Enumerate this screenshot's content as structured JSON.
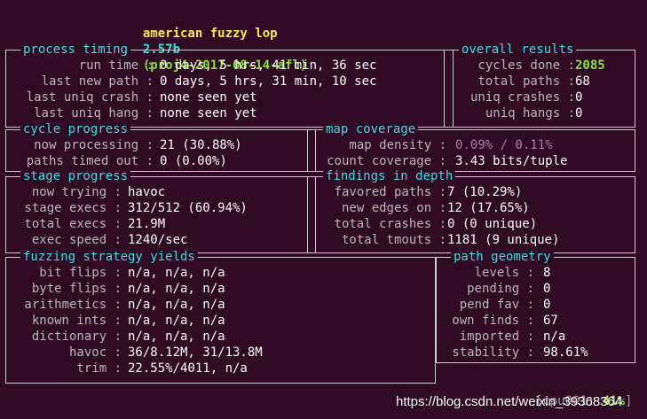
{
  "header": {
    "app_name": "american fuzzy lop",
    "version": "2.57b",
    "banner": "(proj4-2017-08-14-afl)"
  },
  "process_timing": {
    "title": "process timing",
    "rows": [
      {
        "label": "run time",
        "value": "0 days, 5 hrs, 41 min, 36 sec"
      },
      {
        "label": "last new path",
        "value": "0 days, 5 hrs, 31 min, 10 sec"
      },
      {
        "label": "last uniq crash",
        "value": "none seen yet"
      },
      {
        "label": "last uniq hang",
        "value": "none seen yet"
      }
    ]
  },
  "overall_results": {
    "title": "overall results",
    "rows": [
      {
        "label": "cycles done",
        "value": "2085"
      },
      {
        "label": "total paths",
        "value": "68"
      },
      {
        "label": "uniq crashes",
        "value": "0"
      },
      {
        "label": "uniq hangs",
        "value": "0"
      }
    ]
  },
  "cycle_progress": {
    "title": "cycle progress",
    "rows": [
      {
        "label": "now processing",
        "value": "21 (30.88%)"
      },
      {
        "label": "paths timed out",
        "value": "0 (0.00%)"
      }
    ]
  },
  "map_coverage": {
    "title": "map coverage",
    "rows": [
      {
        "label": "map density",
        "value": "0.09% / 0.11%"
      },
      {
        "label": "count coverage",
        "value": "3.43 bits/tuple"
      }
    ]
  },
  "stage_progress": {
    "title": "stage progress",
    "rows": [
      {
        "label": "now trying",
        "value": "havoc"
      },
      {
        "label": "stage execs",
        "value": "312/512 (60.94%)"
      },
      {
        "label": "total execs",
        "value": "21.9M"
      },
      {
        "label": "exec speed",
        "value": "1240/sec"
      }
    ]
  },
  "findings_in_depth": {
    "title": "findings in depth",
    "rows": [
      {
        "label": "favored paths",
        "value": "7 (10.29%)"
      },
      {
        "label": "new edges on",
        "value": "12 (17.65%)"
      },
      {
        "label": "total crashes",
        "value": "0 (0 unique)"
      },
      {
        "label": "total tmouts",
        "value": "1181 (9 unique)"
      }
    ]
  },
  "fuzzing_strategy_yields": {
    "title": "fuzzing strategy yields",
    "rows": [
      {
        "label": "bit flips",
        "value": "n/a, n/a, n/a"
      },
      {
        "label": "byte flips",
        "value": "n/a, n/a, n/a"
      },
      {
        "label": "arithmetics",
        "value": "n/a, n/a, n/a"
      },
      {
        "label": "known ints",
        "value": "n/a, n/a, n/a"
      },
      {
        "label": "dictionary",
        "value": "n/a, n/a, n/a"
      },
      {
        "label": "havoc",
        "value": "36/8.12M, 31/13.8M"
      },
      {
        "label": "trim",
        "value": "22.55%/4011, n/a"
      }
    ]
  },
  "path_geometry": {
    "title": "path geometry",
    "rows": [
      {
        "label": "levels",
        "value": "8"
      },
      {
        "label": "pending",
        "value": "0"
      },
      {
        "label": "pend fav",
        "value": "0"
      },
      {
        "label": "own finds",
        "value": "67"
      },
      {
        "label": "imported",
        "value": "n/a"
      },
      {
        "label": "stability",
        "value": "98.61%"
      }
    ]
  },
  "cpu": {
    "label": "cpu001:",
    "value": "41%"
  },
  "watermark": "https://blog.csdn.net/weixin_39368364",
  "colors": {
    "background": "#300a24",
    "title_yellow": "#fce94f",
    "section_cyan": "#34e2e2",
    "highlight_green": "#8ae234",
    "density_purple": "#ad7fa8"
  }
}
